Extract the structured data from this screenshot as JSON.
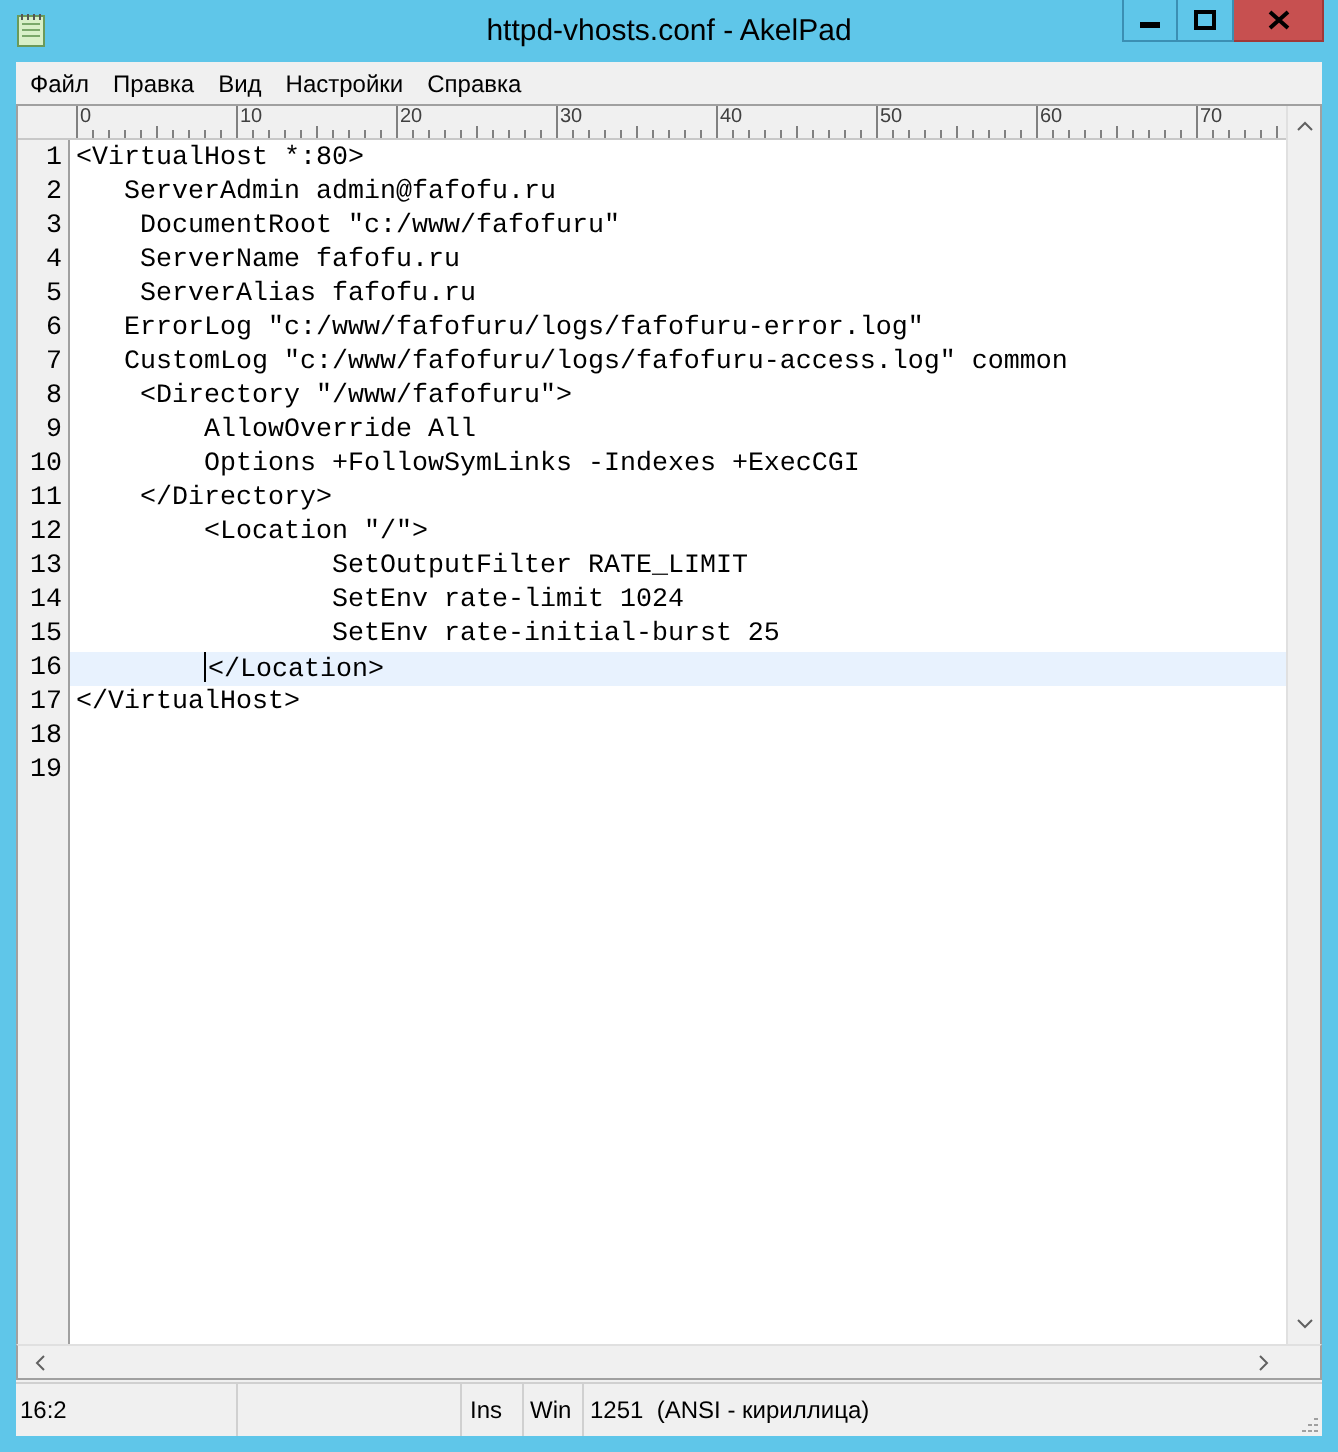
{
  "window": {
    "title": "httpd-vhosts.conf - AkelPad"
  },
  "menu": [
    "Файл",
    "Правка",
    "Вид",
    "Настройки",
    "Справка"
  ],
  "ruler": [
    "0",
    "10",
    "20",
    "30",
    "40",
    "50",
    "60",
    "70"
  ],
  "lines": [
    {
      "number": "1",
      "text": "<VirtualHost *:80>",
      "current": false
    },
    {
      "number": "2",
      "text": "   ServerAdmin admin@fafofu.ru",
      "current": false
    },
    {
      "number": "3",
      "text": "    DocumentRoot \"c:/www/fafofuru\"",
      "current": false
    },
    {
      "number": "4",
      "text": "    ServerName fafofu.ru",
      "current": false
    },
    {
      "number": "5",
      "text": "    ServerAlias fafofu.ru",
      "current": false
    },
    {
      "number": "6",
      "text": "   ErrorLog \"c:/www/fafofuru/logs/fafofuru-error.log\"",
      "current": false
    },
    {
      "number": "7",
      "text": "   CustomLog \"c:/www/fafofuru/logs/fafofuru-access.log\" common",
      "current": false
    },
    {
      "number": "8",
      "text": "    <Directory \"/www/fafofuru\">",
      "current": false
    },
    {
      "number": "9",
      "text": "        AllowOverride All",
      "current": false
    },
    {
      "number": "10",
      "text": "        Options +FollowSymLinks -Indexes +ExecCGI",
      "current": false
    },
    {
      "number": "11",
      "text": "    </Directory>",
      "current": false
    },
    {
      "number": "12",
      "text": "        <Location \"/\">",
      "current": false
    },
    {
      "number": "13",
      "text": "                SetOutputFilter RATE_LIMIT",
      "current": false
    },
    {
      "number": "14",
      "text": "                SetEnv rate-limit 1024",
      "current": false
    },
    {
      "number": "15",
      "text": "                SetEnv rate-initial-burst 25",
      "current": false
    },
    {
      "number": "16",
      "text": "        </Location>",
      "current": true
    },
    {
      "number": "17",
      "text": "</VirtualHost>",
      "current": false
    },
    {
      "number": "18",
      "current": false
    },
    {
      "number": "19",
      "current": false
    }
  ],
  "status_bar": {
    "position": "16:2",
    "mode": "Ins",
    "newline": "Win",
    "encoding": "1251  (ANSI - кириллица)"
  }
}
